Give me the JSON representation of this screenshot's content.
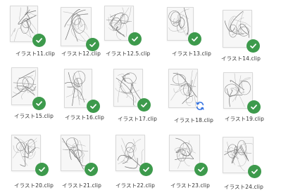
{
  "colors": {
    "synced": "#3d9a4c",
    "syncing": "#2f6fe0",
    "paper": "#f7f7f7",
    "line": "#8a8a8a"
  },
  "files": [
    {
      "name": "イラスト11.clip",
      "status": "synced",
      "icon": "check-icon"
    },
    {
      "name": "イラスト12.clip",
      "status": "synced",
      "icon": "check-icon"
    },
    {
      "name": "イラスト12.5.clip",
      "status": "synced",
      "icon": "check-icon"
    },
    {
      "name": "イラスト13.clip",
      "status": "synced",
      "icon": "check-icon"
    },
    {
      "name": "イラスト14.clip",
      "status": "synced",
      "icon": "check-icon"
    },
    {
      "name": "イラスト15.clip",
      "status": "synced",
      "icon": "check-icon"
    },
    {
      "name": "イラスト16.clip",
      "status": "synced",
      "icon": "check-icon"
    },
    {
      "name": "イラスト17.clip",
      "status": "synced",
      "icon": "check-icon"
    },
    {
      "name": "イラスト18.clip",
      "status": "syncing",
      "icon": "sync-icon"
    },
    {
      "name": "イラスト19.clip",
      "status": "synced",
      "icon": "check-icon"
    },
    {
      "name": "イラスト20.clip",
      "status": "synced",
      "icon": "check-icon"
    },
    {
      "name": "イラスト21.clip",
      "status": "synced",
      "icon": "check-icon"
    },
    {
      "name": "イラスト22.clip",
      "status": "synced",
      "icon": "check-icon"
    },
    {
      "name": "イラスト23.clip",
      "status": "synced",
      "icon": "check-icon"
    },
    {
      "name": "イラスト24.clip",
      "status": "synced",
      "icon": "check-icon"
    }
  ]
}
